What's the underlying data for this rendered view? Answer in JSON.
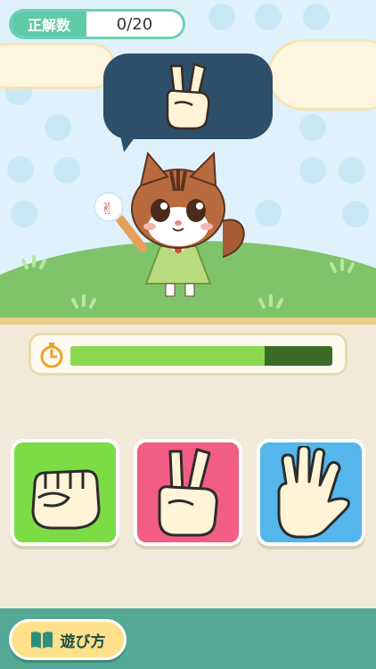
{
  "score": {
    "label": "正解数",
    "value": "0/20"
  },
  "bubble": {
    "icon": "scissors-hand-icon"
  },
  "timer": {
    "icon": "stopwatch-icon",
    "progress": 0.74
  },
  "choices": [
    {
      "name": "rock",
      "icon": "fist-hand-icon",
      "color": "#7bdc45"
    },
    {
      "name": "scissors",
      "icon": "scissors-hand-icon",
      "color": "#f25e83"
    },
    {
      "name": "paper",
      "icon": "open-hand-icon",
      "color": "#55b6eb"
    }
  ],
  "footer": {
    "howto_label": "遊び方",
    "howto_icon": "book-icon"
  },
  "colors": {
    "accent": "#6cd1b2",
    "footer": "#54a995",
    "timer_fill": "#8cd84e",
    "timer_track": "#3c6b26"
  }
}
